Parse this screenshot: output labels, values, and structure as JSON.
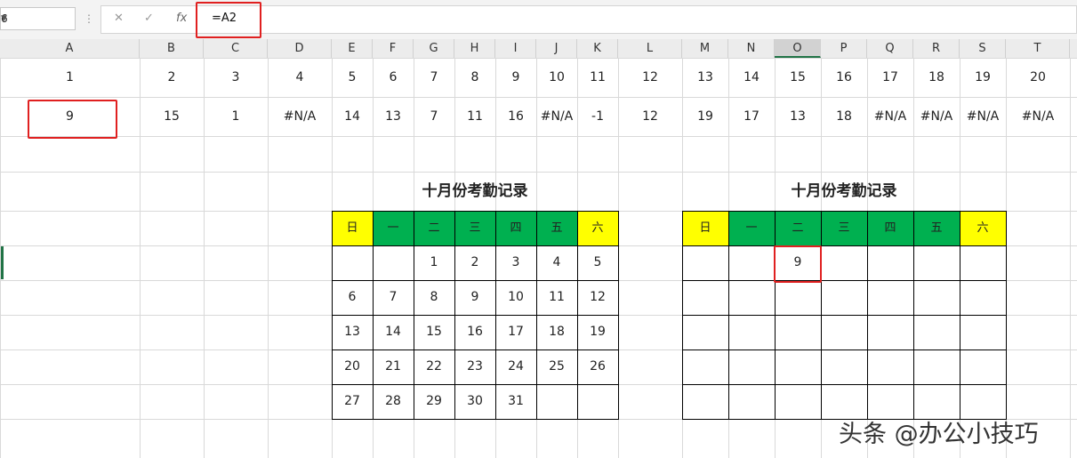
{
  "formula_bar": {
    "name_box": "6",
    "cancel_icon": "✕",
    "enter_icon": "✓",
    "fx_label": "fx",
    "formula": "=A2"
  },
  "columns": [
    "A",
    "B",
    "C",
    "D",
    "E",
    "F",
    "G",
    "H",
    "I",
    "J",
    "K",
    "L",
    "M",
    "N",
    "O",
    "P",
    "Q",
    "R",
    "S",
    "T"
  ],
  "selected_column": "O",
  "row1": [
    "1",
    "2",
    "3",
    "4",
    "5",
    "6",
    "7",
    "8",
    "9",
    "10",
    "11",
    "12",
    "13",
    "14",
    "15",
    "16",
    "17",
    "18",
    "19",
    "20"
  ],
  "row2": [
    "9",
    "15",
    "1",
    "#N/A",
    "14",
    "13",
    "7",
    "11",
    "16",
    "#N/A",
    "-1",
    "12",
    "19",
    "17",
    "13",
    "18",
    "#N/A",
    "#N/A",
    "#N/A",
    "#N/A"
  ],
  "calendar_left": {
    "title": "十月份考勤记录",
    "weekdays": [
      "日",
      "一",
      "二",
      "三",
      "四",
      "五",
      "六"
    ],
    "weeks": [
      [
        "",
        "",
        "1",
        "2",
        "3",
        "4",
        "5"
      ],
      [
        "6",
        "7",
        "8",
        "9",
        "10",
        "11",
        "12"
      ],
      [
        "13",
        "14",
        "15",
        "16",
        "17",
        "18",
        "19"
      ],
      [
        "20",
        "21",
        "22",
        "23",
        "24",
        "25",
        "26"
      ],
      [
        "27",
        "28",
        "29",
        "30",
        "31",
        "",
        ""
      ]
    ]
  },
  "calendar_right": {
    "title": "十月份考勤记录",
    "weekdays": [
      "日",
      "一",
      "二",
      "三",
      "四",
      "五",
      "六"
    ],
    "weeks": [
      [
        "",
        "",
        "9",
        "",
        "",
        "",
        ""
      ],
      [
        "",
        "",
        "",
        "",
        "",
        "",
        ""
      ],
      [
        "",
        "",
        "",
        "",
        "",
        "",
        ""
      ],
      [
        "",
        "",
        "",
        "",
        "",
        "",
        ""
      ],
      [
        "",
        "",
        "",
        "",
        "",
        "",
        ""
      ]
    ]
  },
  "colors": {
    "weekend": "#ffff00",
    "weekday": "#00b050",
    "selection": "#217346",
    "highlight": "#e02020"
  },
  "watermark": "头条 @办公小技巧"
}
